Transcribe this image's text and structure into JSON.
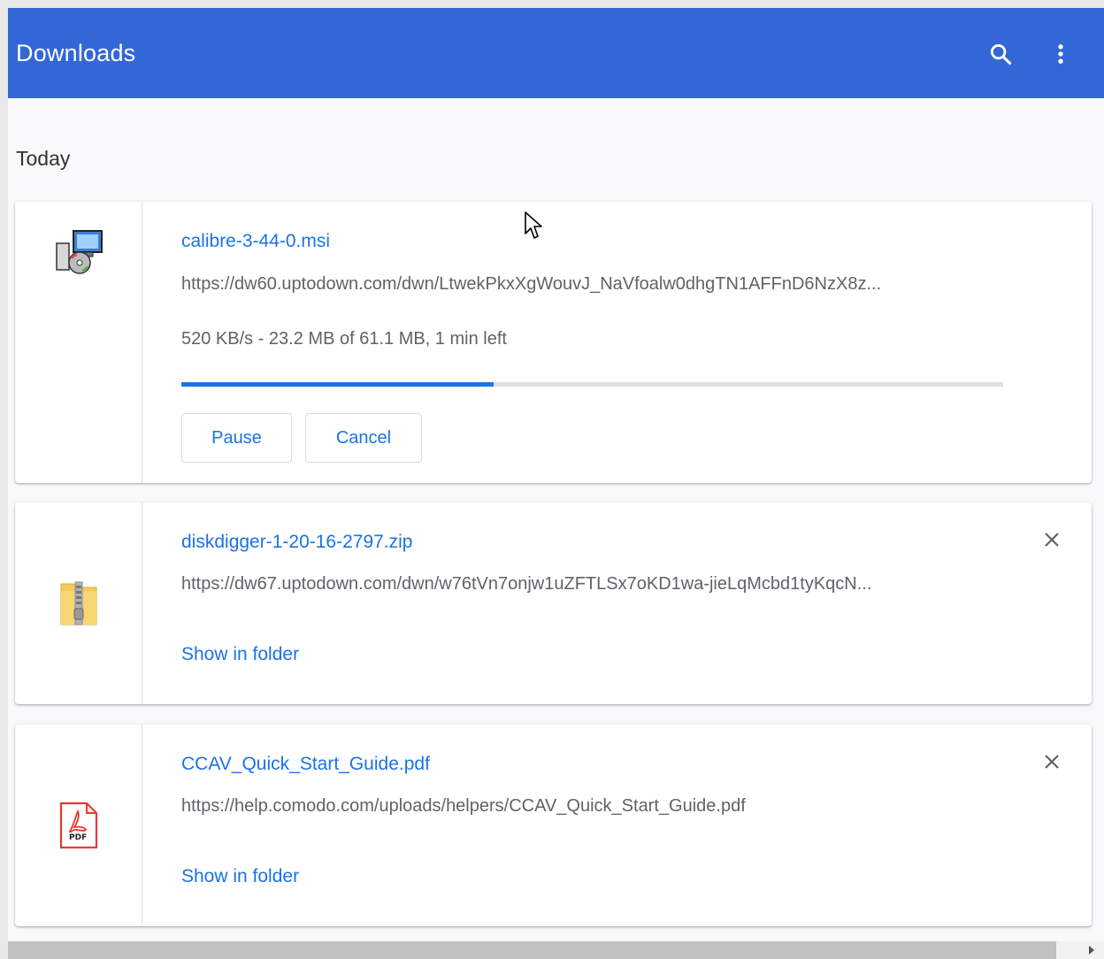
{
  "header": {
    "title": "Downloads",
    "search_icon": "search-icon",
    "menu_icon": "more-vert-icon"
  },
  "section": {
    "title": "Today"
  },
  "downloads": [
    {
      "name": "calibre-3-44-0.msi",
      "url": "https://dw60.uptodown.com/dwn/LtwekPkxXgWouvJ_NaVfoalw0dhgTN1AFFnD6NzX8z...",
      "status": "520 KB/s - 23.2 MB of 61.1 MB, 1 min left",
      "progress": 0.38,
      "pause_label": "Pause",
      "cancel_label": "Cancel",
      "icon": "msi-installer-icon"
    },
    {
      "name": "diskdigger-1-20-16-2797.zip",
      "url": "https://dw67.uptodown.com/dwn/w76tVn7onjw1uZFTLSx7oKD1wa-jieLqMcbd1tyKqcN...",
      "link_label": "Show in folder",
      "icon": "zip-folder-icon"
    },
    {
      "name": "CCAV_Quick_Start_Guide.pdf",
      "url": "https://help.comodo.com/uploads/helpers/CCAV_Quick_Start_Guide.pdf",
      "link_label": "Show in folder",
      "icon": "pdf-file-icon",
      "pdf_badge": "PDF"
    }
  ],
  "colors": {
    "header_bg": "#3367d6",
    "accent": "#1a73e8",
    "text_secondary": "#5f6368"
  }
}
